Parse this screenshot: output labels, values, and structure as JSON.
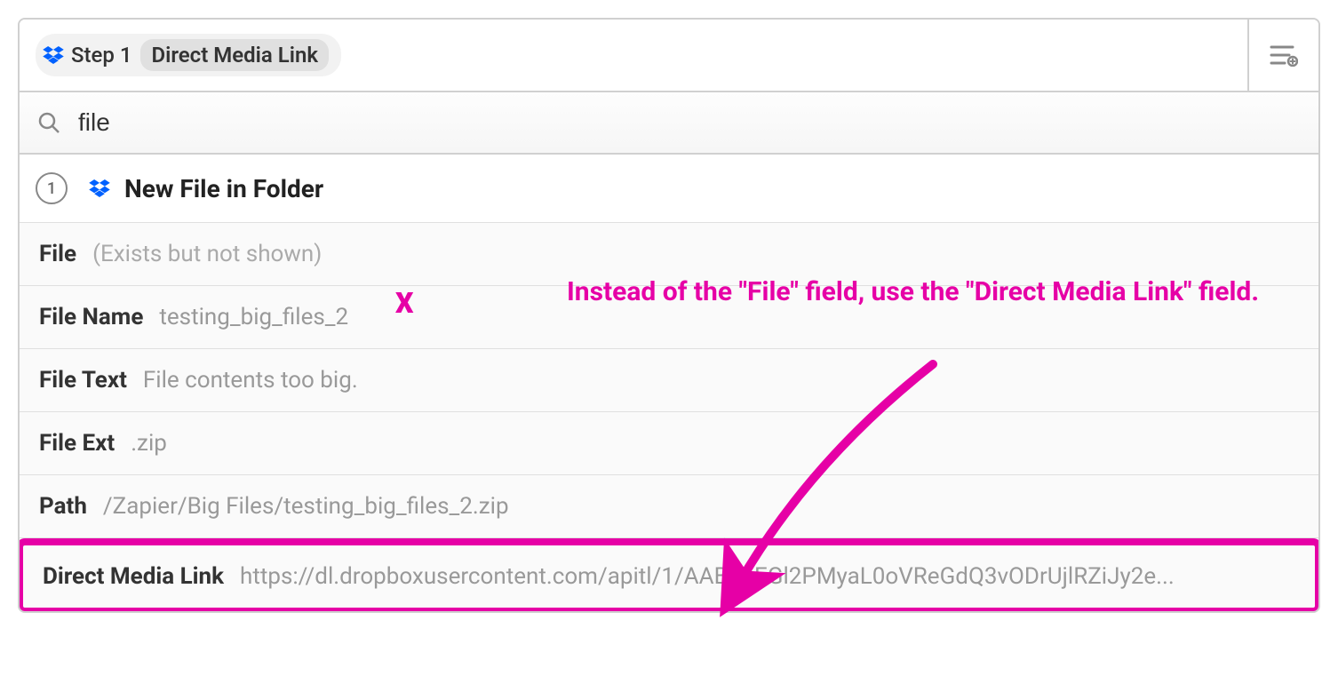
{
  "header": {
    "step_label": "Step 1",
    "step_name": "Direct Media Link"
  },
  "search": {
    "value": "file"
  },
  "source": {
    "step_number": "1",
    "label": "New File in Folder"
  },
  "fields": [
    {
      "label": "File",
      "hint": "(Exists but not shown)",
      "value": ""
    },
    {
      "label": "File Name",
      "value": "testing_big_files_2"
    },
    {
      "label": "File Text",
      "value": "File contents too big."
    },
    {
      "label": "File Ext",
      "value": ".zip"
    },
    {
      "label": "Path",
      "value": "/Zapier/Big Files/testing_big_files_2.zip"
    },
    {
      "label": "Direct Media Link",
      "value": "https://dl.dropboxusercontent.com/apitl/1/AAB2gEGl2PMyaL0oVReGdQ3vODrUjlRZiJy2e..."
    }
  ],
  "annotation": {
    "x_mark": "X",
    "text": "Instead of the \"File\" field, use the \"Direct Media Link\" field."
  }
}
